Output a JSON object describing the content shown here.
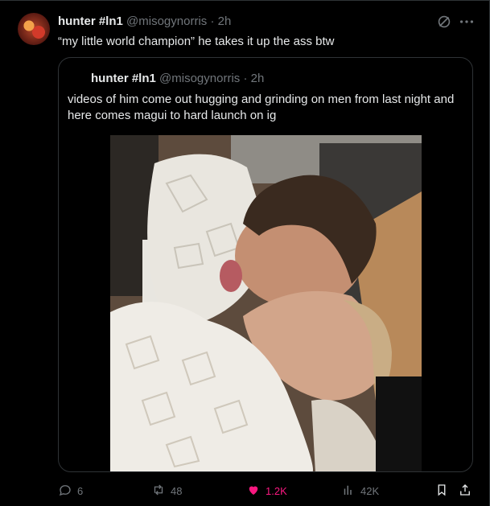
{
  "tweet": {
    "author": {
      "name": "hunter #ln1",
      "handle": "@misogynorris",
      "time": "2h"
    },
    "text": "“my little world champion” he takes it up the ass btw"
  },
  "quote": {
    "author": {
      "name": "hunter #ln1",
      "handle": "@misogynorris",
      "time": "2h"
    },
    "text": "videos of him come out hugging and grinding on men from last night and here comes magui to hard launch on ig"
  },
  "actions": {
    "replies": "6",
    "reposts": "48",
    "likes": "1.2K",
    "views": "42K"
  },
  "colors": {
    "background": "#000000",
    "text": "#e7e9ea",
    "muted": "#71767b",
    "border": "#2f3336",
    "like": "#f91880"
  },
  "icons": [
    "grok-icon",
    "more-icon",
    "reply-icon",
    "repost-icon",
    "heart-icon",
    "views-icon",
    "bookmark-icon",
    "share-icon"
  ]
}
